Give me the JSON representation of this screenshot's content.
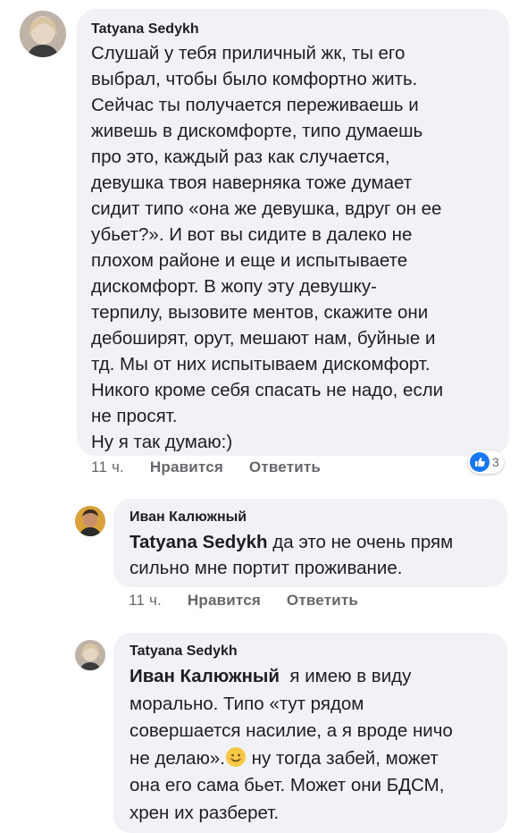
{
  "comments": [
    {
      "author": "Tatyana Sedykh",
      "text": "Слушай у тебя приличный жк, ты его\nвыбрал, чтобы было комфортно жить.\nСейчас ты получается переживаешь и\nживешь в дискомфорте, типо думаешь\nпро это, каждый раз как случается,\nдевушка твоя наверняка тоже думает\nсидит типо «она же девушка, вдруг он ее\nубьет?». И вот вы сидите в далеко не\nплохом районе и еще и испытываете\nдискомфорт. В жопу эту девушку-\nтерпилу, вызовите ментов, скажите они\nдебоширят, орут, мешают нам, буйные и\nтд. Мы от них испытываем дискомфорт.\nНикого кроме себя спасать не надо, если\nне просят.\nНу я так думаю:)",
      "time": "11 ч.",
      "like": "Нравится",
      "reply": "Ответить",
      "reaction_count": "3",
      "reaction_icon": "like-icon",
      "like_color": "#1877f2"
    },
    {
      "author": "Иван Калюжный",
      "mention": "Tatyana Sedykh",
      "text": "да это не очень прям\nсильно мне портит проживание.",
      "time": "11 ч.",
      "like": "Нравится",
      "reply": "Ответить"
    },
    {
      "author": "Tatyana Sedykh",
      "mention": "Иван Калюжный",
      "text_line1": "я имею в виду",
      "text_line2": "морально. Типо «тут рядом",
      "text_line3": "совершается насилие, а я вроде ничо",
      "text_line4a": "не делаю».",
      "emoji": "smiling-face-icon",
      "text_line4b": "ну тогда забей, может",
      "text_line5": "она его сама бьет. Может они БДСМ,",
      "text_line6": "хрен их разберет."
    }
  ],
  "colors": {
    "bubble": "#f0f2f5",
    "secondary_text": "#65676b"
  }
}
